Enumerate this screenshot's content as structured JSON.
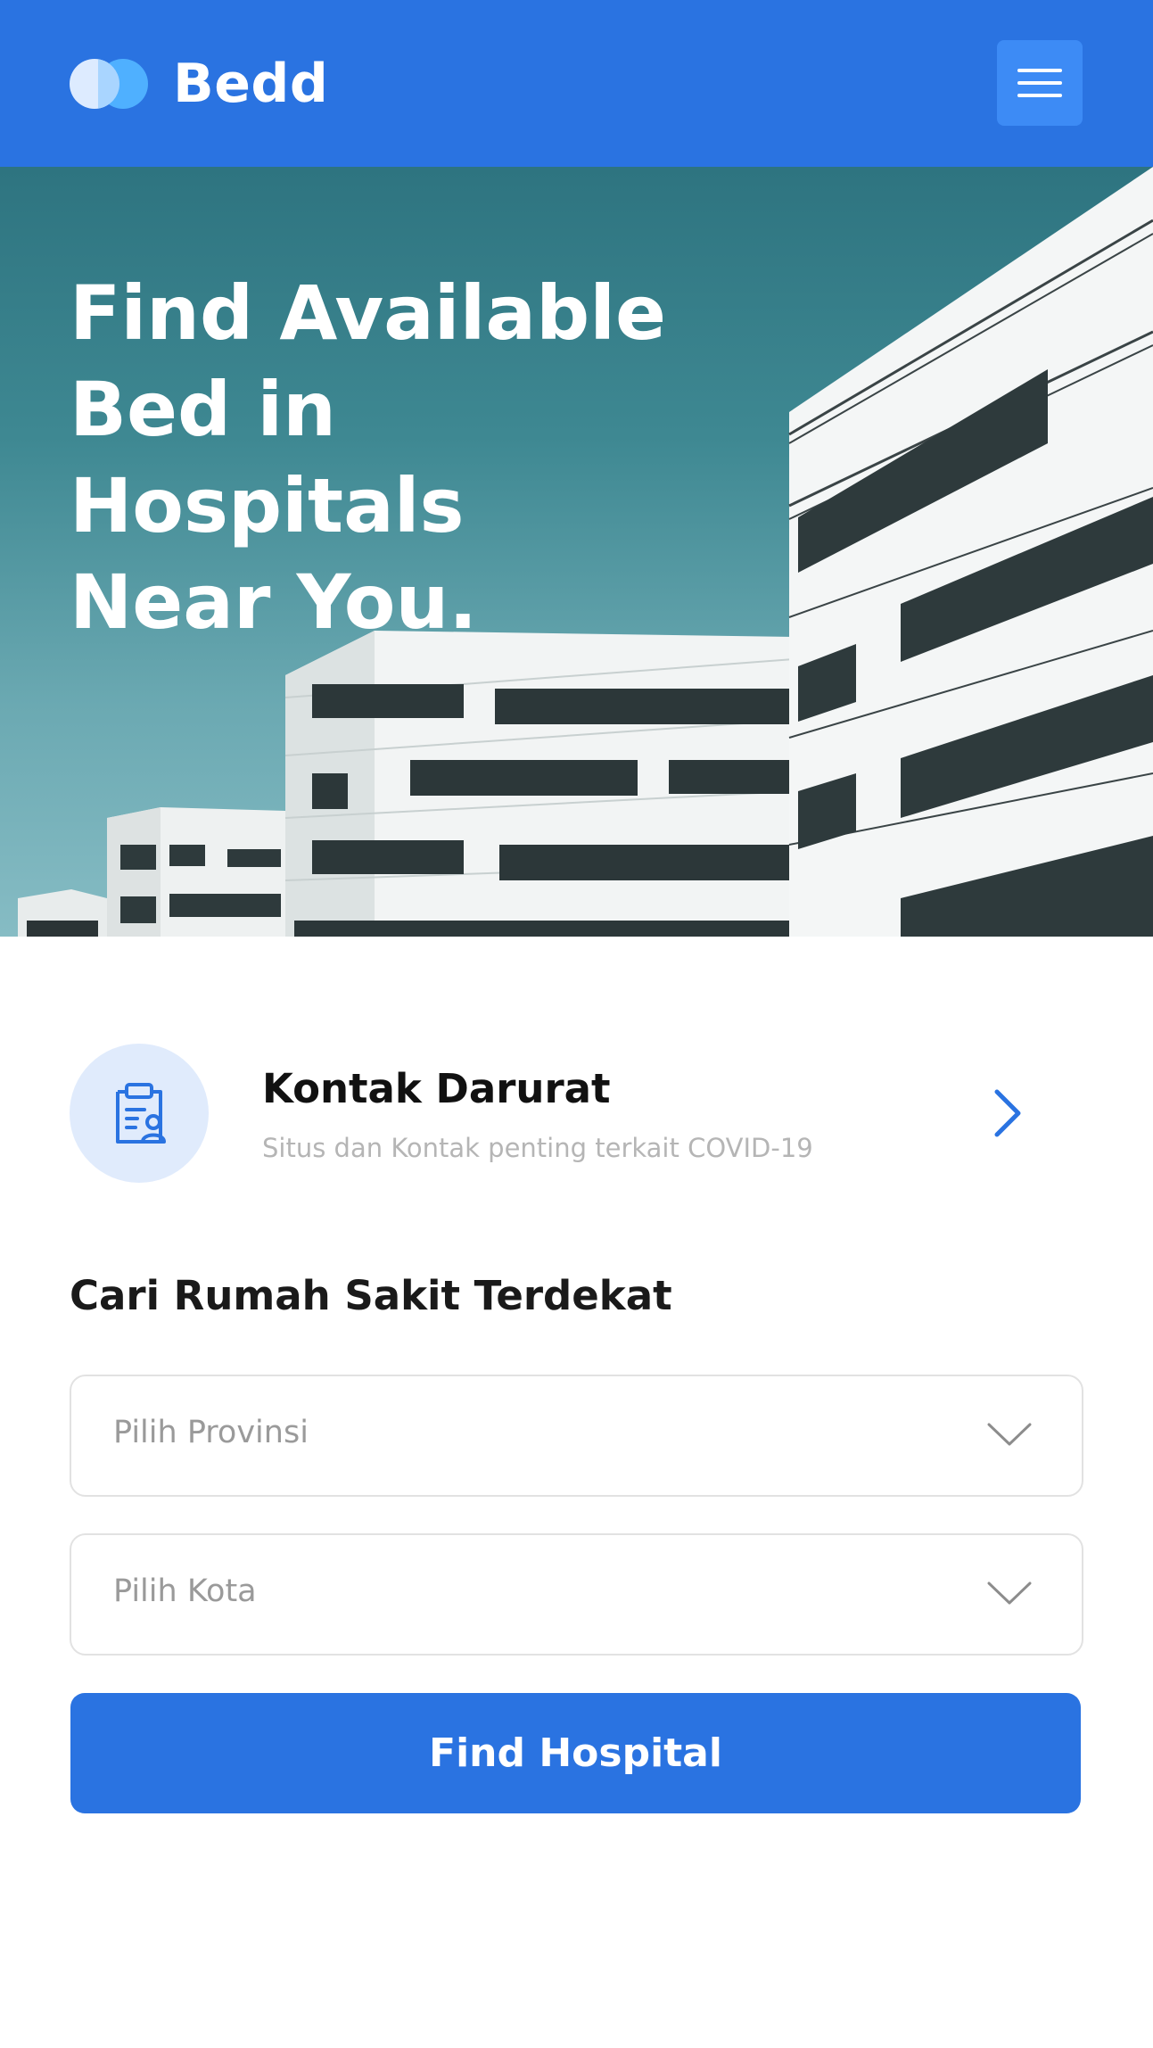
{
  "header": {
    "brand": "Bedd",
    "logo_icon": "overlapping-circles-logo",
    "menu_icon": "hamburger-menu-icon",
    "color": "#2A73E1"
  },
  "hero": {
    "title": "Find Available\nBed in Hospitals\nNear You.",
    "image": "hospital-buildings-photo"
  },
  "emergency_contact": {
    "title": "Kontak Darurat",
    "subtitle": "Situs dan Kontak penting terkait COVID-19",
    "icon": "clipboard-user-icon",
    "chevron_icon": "chevron-right-icon"
  },
  "search": {
    "title": "Cari Rumah Sakit Terdekat",
    "province_select": {
      "placeholder": "Pilih Provinsi",
      "icon": "chevron-down-icon"
    },
    "city_select": {
      "placeholder": "Pilih Kota",
      "icon": "chevron-down-icon"
    },
    "submit_label": "Find Hospital"
  }
}
